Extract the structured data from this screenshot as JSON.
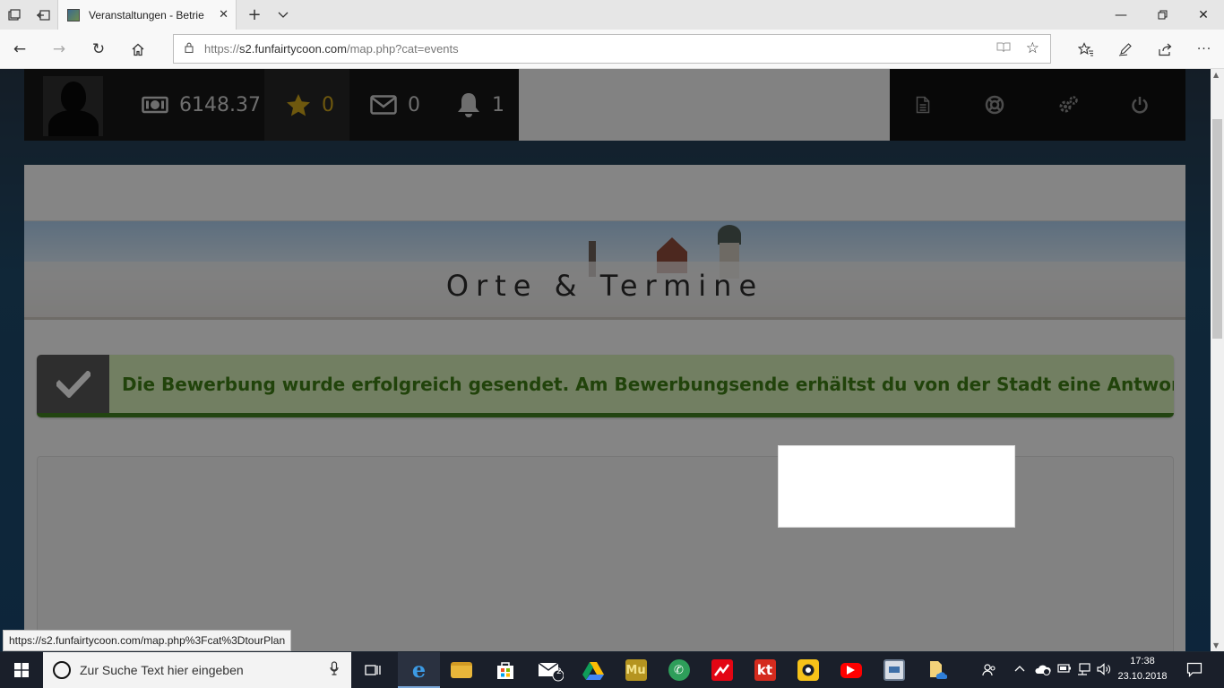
{
  "browser": {
    "tab_title": "Veranstaltungen - Betrie",
    "url_prefix": "https://",
    "url_host": "s2.funfairtycoon.com",
    "url_path": "/map.php?cat=events",
    "status_url": "https://s2.funfairtycoon.com/map.php%3Fcat%3DtourPlan"
  },
  "gamebar": {
    "money": "6148.37",
    "stars": "0",
    "messages": "0",
    "notifications": "1"
  },
  "page": {
    "title": "Orte & Termine",
    "alert_text": "Die Bewerbung wurde erfolgreich gesendet. Am Bewerbungsende erhältst du von der Stadt eine Antwort."
  },
  "taskbar": {
    "search_placeholder": "Zur Suche Text hier eingeben",
    "mail_badge": "2",
    "time": "17:38",
    "date": "23.10.2018",
    "app_kt_label": "kt",
    "app_mu_label": "Mu"
  },
  "colors": {
    "alert_bg": "#cfe8b3",
    "alert_text": "#3d7a14",
    "star_accent": "#c8a01a"
  }
}
